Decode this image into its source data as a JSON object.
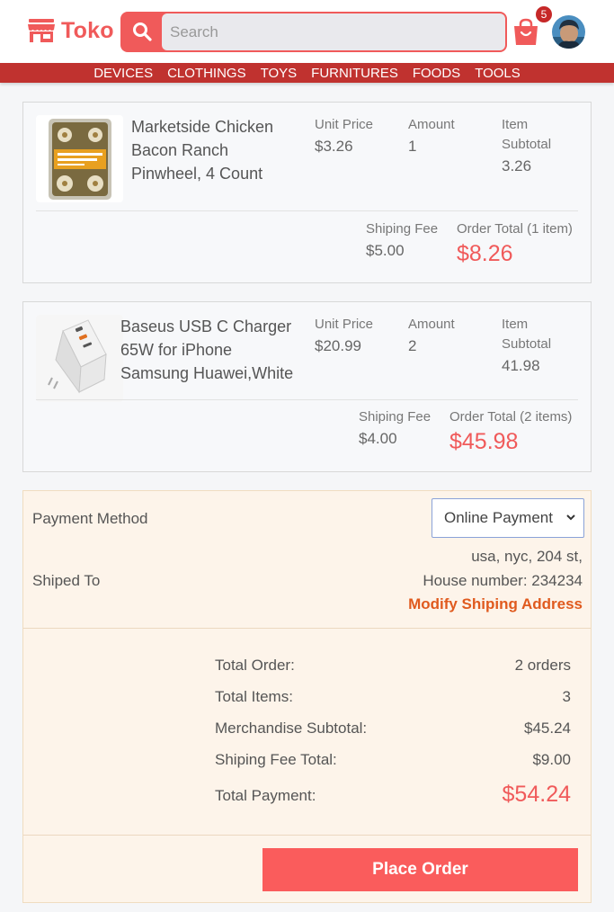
{
  "header": {
    "logo_text": "Toko",
    "search_placeholder": "Search",
    "cart_count": "5",
    "brand_color": "#f05a5a"
  },
  "nav": {
    "items": [
      "DEVICES",
      "CLOTHINGS",
      "TOYS",
      "FURNITURES",
      "FOODS",
      "TOOLS"
    ]
  },
  "orders": [
    {
      "name_lines": [
        "Marketside Chicken",
        "Bacon Ranch",
        "Pinwheel, 4 Count"
      ],
      "unit_price_label": "Unit Price",
      "unit_price": "$3.26",
      "amount_label": "Amount",
      "amount": "1",
      "subtotal_label_1": "Item",
      "subtotal_label_2": "Subtotal",
      "subtotal": "3.26",
      "fee_label": "Shiping Fee",
      "fee": "$5.00",
      "total_label": "Order Total (1 item)",
      "total": "$8.26"
    },
    {
      "name_lines": [
        "Baseus USB C Charger",
        "65W for iPhone",
        "Samsung Huawei,White"
      ],
      "unit_price_label": "Unit Price",
      "unit_price": "$20.99",
      "amount_label": "Amount",
      "amount": "2",
      "subtotal_label_1": "Item",
      "subtotal_label_2": "Subtotal",
      "subtotal": "41.98",
      "fee_label": "Shiping Fee",
      "fee": "$4.00",
      "total_label": "Order Total (2 items)",
      "total": "$45.98"
    }
  ],
  "summary": {
    "payment_label": "Payment Method",
    "payment_selected": "Online Payment",
    "ship_label": "Shiped To",
    "address_line1": "usa, nyc, 204 st,",
    "address_line2": "House number: 234234",
    "modify_label": "Modify Shiping Address",
    "rows": [
      {
        "label": "Total Order:",
        "value": "2 orders"
      },
      {
        "label": "Total Items:",
        "value": "3"
      },
      {
        "label": "Merchandise Subtotal:",
        "value": "$45.24"
      },
      {
        "label": "Shiping Fee Total:",
        "value": "$9.00"
      }
    ],
    "total_payment_label": "Total Payment:",
    "total_payment": "$54.24",
    "place_order_label": "Place Order"
  }
}
